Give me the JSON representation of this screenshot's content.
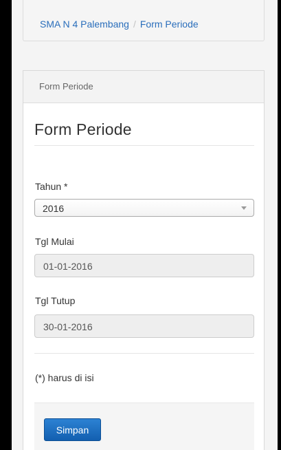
{
  "breadcrumb": {
    "items": [
      "SMA N 4 Palembang",
      "Form Periode"
    ],
    "separator": "/"
  },
  "panel": {
    "heading": "Form Periode",
    "title": "Form Periode"
  },
  "form": {
    "tahun": {
      "label": "Tahun *",
      "value": "2016"
    },
    "tgl_mulai": {
      "label": "Tgl Mulai",
      "value": "01-01-2016"
    },
    "tgl_tutup": {
      "label": "Tgl Tutup",
      "value": "30-01-2016"
    },
    "required_note": "(*) harus di isi",
    "save_label": "Simpan"
  },
  "colors": {
    "link": "#2a6ebb",
    "primary_button": "#1a6cc2",
    "frame": "#000000"
  }
}
